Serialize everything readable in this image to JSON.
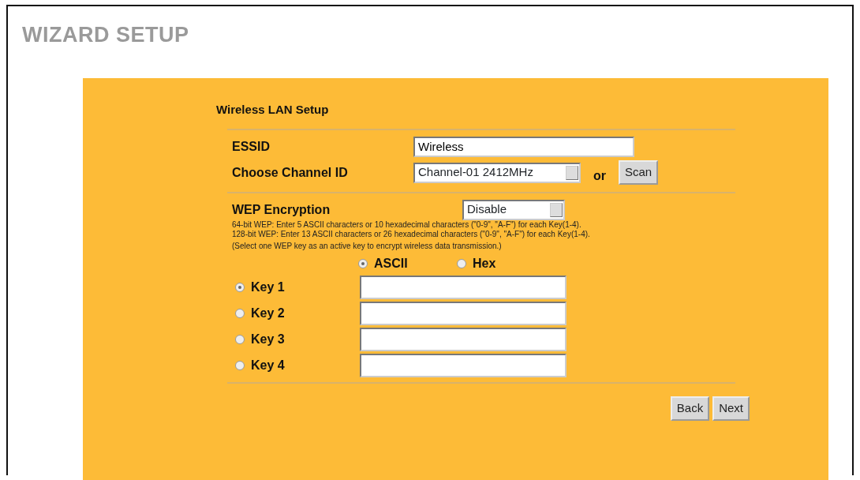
{
  "page_title": "WIZARD SETUP",
  "section_title": "Wireless LAN Setup",
  "essid": {
    "label": "ESSID",
    "value": "Wireless"
  },
  "channel": {
    "label": "Choose Channel ID",
    "value": "Channel-01 2412MHz",
    "separator": "or",
    "scan_button": "Scan"
  },
  "wep": {
    "label": "WEP Encryption",
    "value": "Disable",
    "help": [
      "64-bit WEP: Enter 5 ASCII characters or 10 hexadecimal characters (\"0-9\", \"A-F\") for each Key(1-4).",
      "128-bit WEP: Enter 13 ASCII characters or 26 hexadecimal characters (\"0-9\", \"A-F\") for each Key(1-4).",
      "(Select one WEP key as an active key to encrypt wireless data transmission.)"
    ]
  },
  "key_format": [
    {
      "label": "ASCII",
      "selected": true
    },
    {
      "label": "Hex",
      "selected": false
    }
  ],
  "keys": [
    {
      "label": "Key 1",
      "selected": true
    },
    {
      "label": "Key 2",
      "selected": false
    },
    {
      "label": "Key 3",
      "selected": false
    },
    {
      "label": "Key 4",
      "selected": false
    }
  ],
  "buttons": [
    "Back",
    "Next"
  ]
}
